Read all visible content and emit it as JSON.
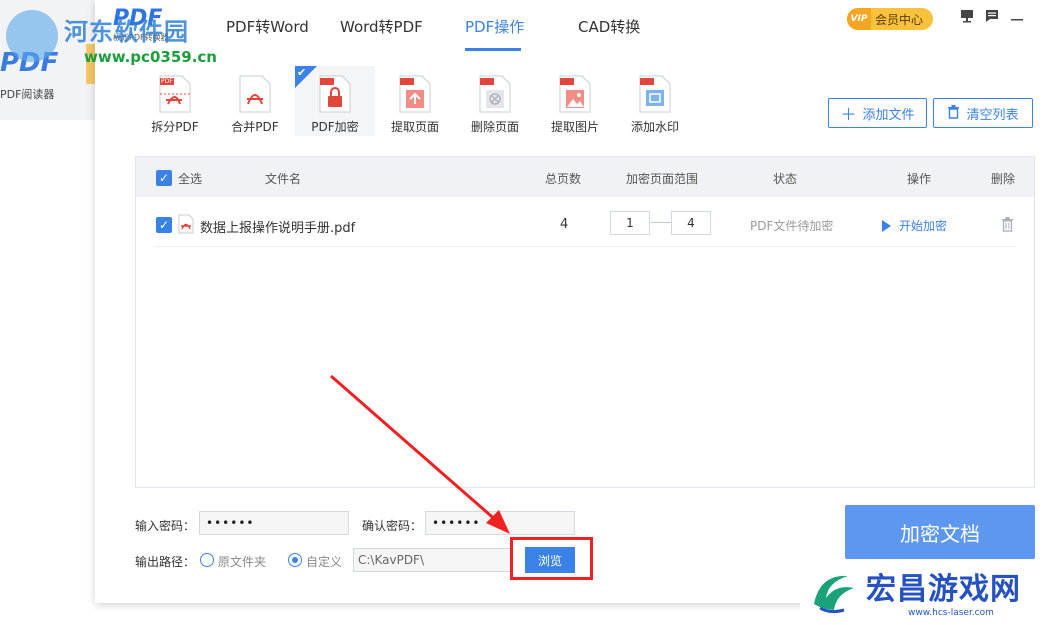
{
  "background_app": {
    "logo": "PDF",
    "label": "PDF阅读器"
  },
  "watermark_left": {
    "title": "河东软件园",
    "url": "www.pc0359.cn"
  },
  "watermark_right": {
    "title": "宏昌游戏网",
    "url": "www.hcs-laser.com"
  },
  "app": {
    "logo": "PDF",
    "subtitle": "极光PDF转换器"
  },
  "nav": {
    "tabs": [
      "PDF转Word",
      "Word转PDF",
      "PDF操作",
      "CAD转换"
    ],
    "active": "PDF操作"
  },
  "header": {
    "vip_badge": "VIP",
    "vip_label": "会员中心"
  },
  "tools": [
    {
      "label": "拆分PDF",
      "icon": "split-pdf-icon"
    },
    {
      "label": "合并PDF",
      "icon": "merge-pdf-icon"
    },
    {
      "label": "PDF加密",
      "icon": "encrypt-pdf-icon",
      "active": true
    },
    {
      "label": "提取页面",
      "icon": "extract-page-icon"
    },
    {
      "label": "删除页面",
      "icon": "delete-page-icon"
    },
    {
      "label": "提取图片",
      "icon": "extract-image-icon"
    },
    {
      "label": "添加水印",
      "icon": "add-watermark-icon"
    }
  ],
  "tool_icon_tag": "PDF",
  "actions": {
    "add_file": "添加文件",
    "clear_list": "清空列表"
  },
  "table": {
    "headers": {
      "select_all": "全选",
      "filename": "文件名",
      "total_pages": "总页数",
      "range": "加密页面范围",
      "status": "状态",
      "operation": "操作",
      "delete": "删除"
    },
    "rows": [
      {
        "filename": "数据上报操作说明手册.pdf",
        "total_pages": "4",
        "range_from": "1",
        "range_to": "4",
        "status": "PDF文件待加密",
        "action": "开始加密"
      }
    ]
  },
  "form": {
    "password_label": "输入密码：",
    "password_value": "••••••",
    "confirm_label": "确认密码：",
    "confirm_value": "••••••",
    "output_label": "输出路径：",
    "option_original": "原文件夹",
    "option_custom": "自定义",
    "path_value": "C:\\KavPDF\\",
    "browse": "浏览"
  },
  "encrypt_button": "加密文档",
  "colors": {
    "accent": "#3b82e6",
    "annotation": "#ee2222",
    "vip": "#f9c23c"
  }
}
